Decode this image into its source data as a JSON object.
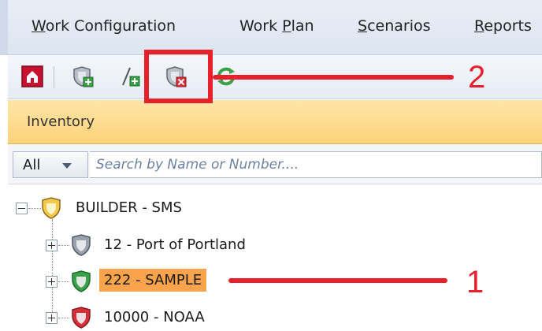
{
  "menu": {
    "items": [
      {
        "name": "work-configuration",
        "pre": "",
        "u": "W",
        "post": "ork Configuration"
      },
      {
        "name": "work-plan",
        "pre": "Work ",
        "u": "P",
        "post": "lan"
      },
      {
        "name": "scenarios",
        "pre": "",
        "u": "S",
        "post": "cenarios"
      },
      {
        "name": "reports",
        "pre": "",
        "u": "R",
        "post": "eports"
      }
    ]
  },
  "toolbar": {
    "icons": [
      "home-icon",
      "add-shield-icon",
      "add-line-icon",
      "remove-shield-icon",
      "refresh-icon"
    ]
  },
  "section": {
    "title": "Inventory"
  },
  "search": {
    "filter_value": "All",
    "placeholder": "Search by Name or Number...."
  },
  "tree": {
    "root": {
      "label": "BUILDER - SMS",
      "expanded": true
    },
    "children": [
      {
        "label": "12 - Port of Portland",
        "shield_color": "#9aa3ad",
        "selected": false
      },
      {
        "label": "222 - SAMPLE",
        "shield_color": "#3aa04a",
        "selected": true
      },
      {
        "label": "10000 - NOAA",
        "shield_color": "#d4303a",
        "selected": false
      }
    ]
  },
  "annotations": {
    "label_1": "1",
    "label_2": "2",
    "color": "#e8202b"
  }
}
